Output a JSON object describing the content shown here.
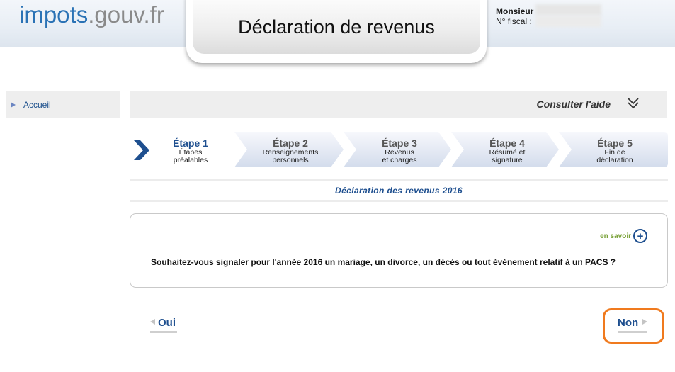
{
  "header": {
    "logo_part1": "impots",
    "logo_part2": ".gouv.fr",
    "title": "Déclaration de revenus",
    "user_title": "Monsieur",
    "fiscal_label": "N° fiscal :"
  },
  "sidebar": {
    "home_label": "Accueil"
  },
  "help": {
    "label": "Consulter l'aide"
  },
  "steps": [
    {
      "title": "Étape 1",
      "line1": "Étapes",
      "line2": "préalables"
    },
    {
      "title": "Étape 2",
      "line1": "Renseignements",
      "line2": "personnels"
    },
    {
      "title": "Étape 3",
      "line1": "Revenus",
      "line2": "et charges"
    },
    {
      "title": "Étape 4",
      "line1": "Résumé et",
      "line2": "signature"
    },
    {
      "title": "Étape 5",
      "line1": "Fin de",
      "line2": "déclaration"
    }
  ],
  "declaration": {
    "heading": "Déclaration des revenus 2016",
    "learn_more": "en savoir",
    "question": "Souhaitez-vous signaler pour l'année 2016 un mariage, un divorce, un décès ou tout événement relatif à un PACS ?"
  },
  "answers": {
    "yes": "Oui",
    "no": "Non"
  },
  "colors": {
    "brand_blue": "#2a72b5",
    "link_blue": "#1e4f8f",
    "highlight_orange": "#f07a1e",
    "learn_green": "#7aa23a"
  }
}
